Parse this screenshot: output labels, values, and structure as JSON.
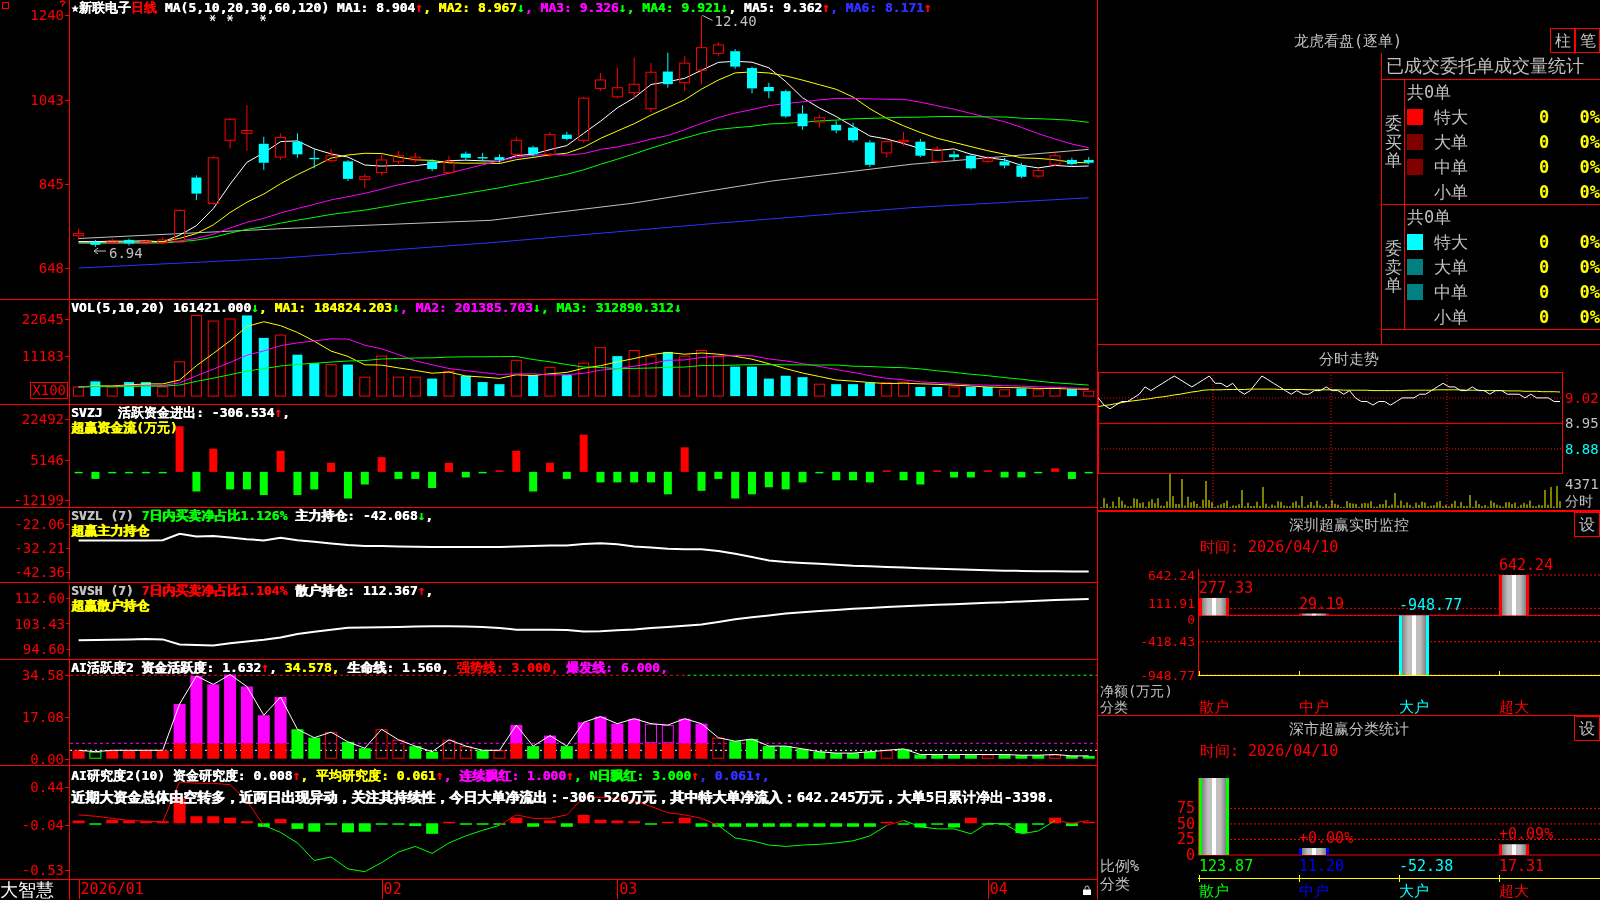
{
  "panels": [
    {
      "kind": "candles",
      "legend_lines": [
        [
          {
            "text": "★新联电子",
            "color": "#ffffff"
          },
          {
            "text": "日线",
            "color": "#ff0000"
          },
          {
            "text": " MA(5,10,20,30,60,120) MA1: 8.904",
            "color": "#ffffff"
          },
          {
            "text": "↑",
            "color": "#ff0000"
          },
          {
            "text": ", MA2: 8.967",
            "color": "#ffff00"
          },
          {
            "text": "↓",
            "color": "#00ff00"
          },
          {
            "text": ", MA3: 9.326",
            "color": "#ff00ff"
          },
          {
            "text": "↓",
            "color": "#00ff00"
          },
          {
            "text": ", MA4: 9.921",
            "color": "#00ff00"
          },
          {
            "text": "↓",
            "color": "#00ff00"
          },
          {
            "text": ", MA5: 9.362",
            "color": "#ffffff"
          },
          {
            "text": "↑",
            "color": "#ff0000"
          },
          {
            "text": ", MA6: 8.171",
            "color": "#3030ff"
          },
          {
            "text": "↑",
            "color": "#ff0000"
          }
        ]
      ],
      "yticks": [
        "1240",
        "1043",
        "845",
        "648"
      ],
      "peak_label": "12.40",
      "low_label": "6.94"
    },
    {
      "kind": "volume",
      "legend_lines": [
        [
          {
            "text": "VOL(5,10,20) 161421.000",
            "color": "#ffffff"
          },
          {
            "text": "↓",
            "color": "#00ff00"
          },
          {
            "text": ", MA1: 184824.203",
            "color": "#ffff00"
          },
          {
            "text": "↓",
            "color": "#00ff00"
          },
          {
            "text": ", MA2: 201385.703",
            "color": "#ff00ff"
          },
          {
            "text": "↓",
            "color": "#00ff00"
          },
          {
            "text": ", MA3: 312890.312",
            "color": "#00ff00"
          },
          {
            "text": "↓",
            "color": "#00ff00"
          }
        ]
      ],
      "yticks": [
        "22645",
        "11183"
      ],
      "unit": "X100"
    },
    {
      "kind": "flow_bars",
      "legend_lines": [
        [
          {
            "text": "SVZJ  活跃资金进出: -306.534",
            "color": "#ffffff"
          },
          {
            "text": "↑",
            "color": "#ff0000"
          },
          {
            "text": ",",
            "color": "#ffffff"
          }
        ],
        [
          {
            "text": "超赢资金流(万元)",
            "color": "#ffff00"
          }
        ]
      ],
      "yticks": [
        "22492",
        "5146",
        "-12199"
      ]
    },
    {
      "kind": "holding_line",
      "legend_lines": [
        [
          {
            "text": "SVZL (7) ",
            "color": "#c0c0c0"
          },
          {
            "text": "7日内买卖净占比1.126%",
            "color": "#00ff00"
          },
          {
            "text": " 主力持仓: -42.068",
            "color": "#ffffff"
          },
          {
            "text": "↓",
            "color": "#00ff00"
          },
          {
            "text": ",",
            "color": "#ffffff"
          }
        ],
        [
          {
            "text": "超赢主力持仓",
            "color": "#ffff00"
          }
        ]
      ],
      "chart_data": {
        "type": "line",
        "ylim": [
          -45.74,
          -16.14
        ],
        "yticks": [
          {
            "value": -22.06,
            "label": "-22.06"
          },
          {
            "value": -32.21,
            "label": "-32.21"
          },
          {
            "value": -42.36,
            "label": "-42.36"
          }
        ],
        "series": [
          {
            "color": "#ffffff",
            "values": [
              -29.1,
              -29.1,
              -29.1,
              -29.1,
              -29.1,
              -28.9,
              -26.2,
              -27.3,
              -27.1,
              -27.8,
              -28.5,
              -29.0,
              -27.9,
              -28.9,
              -29.6,
              -30.3,
              -31.0,
              -31.3,
              -31.4,
              -31.6,
              -31.7,
              -31.8,
              -31.8,
              -31.8,
              -31.8,
              -31.8,
              -31.6,
              -31.4,
              -31.2,
              -31.2,
              -30.5,
              -30.2,
              -30.6,
              -31.6,
              -32.0,
              -32.5,
              -32.7,
              -32.7,
              -33.5,
              -34.6,
              -36.0,
              -37.5,
              -38.1,
              -38.5,
              -38.9,
              -39.3,
              -39.7,
              -39.9,
              -40.2,
              -40.5,
              -40.8,
              -41.0,
              -41.2,
              -41.4,
              -41.6,
              -41.8,
              -41.9,
              -42.0,
              -42.0,
              -42.1,
              -42.1
            ]
          }
        ]
      }
    },
    {
      "kind": "holding_line",
      "legend_lines": [
        [
          {
            "text": "SVSH (7) ",
            "color": "#c0c0c0"
          },
          {
            "text": "7日内买卖净占比1.104%",
            "color": "#ff0000"
          },
          {
            "text": " 散户持仓: 112.367",
            "color": "#ffffff"
          },
          {
            "text": "↑",
            "color": "#ff0000"
          },
          {
            "text": ",",
            "color": "#ffffff"
          }
        ],
        [
          {
            "text": "超赢散户持仓",
            "color": "#ffff00"
          }
        ]
      ],
      "chart_data": {
        "type": "line",
        "ylim": [
          91.78,
          117.19
        ],
        "yticks": [
          {
            "value": 112.6,
            "label": "112.60"
          },
          {
            "value": 103.43,
            "label": "103.43"
          },
          {
            "value": 94.6,
            "label": "94.60"
          }
        ],
        "series": [
          {
            "color": "#ffffff",
            "values": [
              97.7,
              97.8,
              97.9,
              98.0,
              98.1,
              98.0,
              96.2,
              96.0,
              95.8,
              96.6,
              97.3,
              97.9,
              98.7,
              99.9,
              100.7,
              101.4,
              102.1,
              102.2,
              102.3,
              102.4,
              102.5,
              102.6,
              102.6,
              102.5,
              102.4,
              102.0,
              101.4,
              101.4,
              101.4,
              101.3,
              100.8,
              100.9,
              101.2,
              101.5,
              102.0,
              102.4,
              102.8,
              103.2,
              104.1,
              105.1,
              105.8,
              106.4,
              107.1,
              107.6,
              108.0,
              108.4,
              108.8,
              109.1,
              109.4,
              109.7,
              110.0,
              110.2,
              110.4,
              110.7,
              110.9,
              111.1,
              111.4,
              111.6,
              111.9,
              112.1,
              112.3
            ]
          }
        ]
      }
    },
    {
      "kind": "activity_bars",
      "legend_lines": [
        [
          {
            "text": "AI活跃度2 资金活跃度: 1.632",
            "color": "#ffffff"
          },
          {
            "text": "↑",
            "color": "#ff0000"
          },
          {
            "text": ",",
            "color": "#ffffff"
          },
          {
            "text": " 34.578,",
            "color": "#ffff00"
          },
          {
            "text": " 生命线: 1.560,",
            "color": "#ffffff"
          },
          {
            "text": " 强势线: 3.000,",
            "color": "#ff0000"
          },
          {
            "text": " 爆发线: 6.000,",
            "color": "#ff00ff"
          }
        ]
      ],
      "yticks": [
        "34.58",
        "17.08",
        "0.00"
      ]
    },
    {
      "kind": "research_bars",
      "legend_lines": [
        [
          {
            "text": "AI研究度2(10) 资金研究度: 0.008",
            "color": "#ffffff"
          },
          {
            "text": "↑",
            "color": "#ff0000"
          },
          {
            "text": ", 平均研究度: 0.061",
            "color": "#ffff00"
          },
          {
            "text": "↑",
            "color": "#ff0000"
          },
          {
            "text": ", 连续飘红: 1.000",
            "color": "#ff00ff"
          },
          {
            "text": "↑",
            "color": "#ff0000"
          },
          {
            "text": ", N日飘红: 3.000",
            "color": "#00ff00"
          },
          {
            "text": "↑",
            "color": "#ff0000"
          },
          {
            "text": ", 0.061",
            "color": "#3030ff"
          },
          {
            "text": "↑,",
            "color": "#3030ff"
          }
        ],
        [
          {
            "text": "近期大资金总体由空转多，近两日出现异动，关注其持续性，今日大单净流出：-306.526万元，其中特大单净流入：642.245万元，大单5日累计净出-3398.",
            "color": "#ffffff"
          }
        ]
      ],
      "yticks": [
        "0.44",
        "-0.04",
        "-0.53"
      ]
    }
  ],
  "date_axis": {
    "brand": "大智慧",
    "labels": [
      "2026/01",
      "02",
      "03",
      "04"
    ]
  },
  "dragon_tiger": {
    "title": "龙虎看盘(逐单)",
    "view_buttons": [
      "柱",
      "笔"
    ],
    "stats_title": "已成交委托单成交量统计",
    "groups": [
      {
        "label": "委买单",
        "total": "共0单",
        "rows": [
          {
            "label": "特大",
            "color": "#ff0000",
            "count": "0",
            "percent": "0%"
          },
          {
            "label": "大单",
            "color": "#800000",
            "count": "0",
            "percent": "0%"
          },
          {
            "label": "中单",
            "color": "#800000",
            "count": "0",
            "percent": "0%"
          },
          {
            "label": "小单",
            "count": "0",
            "percent": "0%"
          }
        ]
      },
      {
        "label": "委卖单",
        "total": "共0单",
        "rows": [
          {
            "label": "特大",
            "color": "#00ffff",
            "count": "0",
            "percent": "0%"
          },
          {
            "label": "大单",
            "color": "#008080",
            "count": "0",
            "percent": "0%"
          },
          {
            "label": "中单",
            "color": "#008080",
            "count": "0",
            "percent": "0%"
          },
          {
            "label": "小单",
            "count": "0",
            "percent": "0%"
          }
        ]
      }
    ]
  },
  "intraday": {
    "title": "分时走势",
    "price_label_styles": [
      {
        "color": "#ff0000"
      },
      {
        "color": "#c0c0c0"
      },
      {
        "color": "#00ffff"
      }
    ],
    "chart_data": {
      "type": "line",
      "ylim": [
        8.811,
        9.091
      ],
      "yticks": [
        {
          "value": 9.02,
          "label": "9.02"
        },
        {
          "value": 8.95,
          "label": "8.95"
        },
        {
          "value": 8.88,
          "label": "8.88"
        }
      ],
      "grid": true,
      "ref_lines": [
        {
          "axis": "y",
          "value": 8.95
        }
      ],
      "series": [
        {
          "color": "#ffffff",
          "values": [
            9.02,
            9.0,
            8.99,
            9.0,
            9.01,
            9.01,
            9.02,
            9.03,
            9.05,
            9.04,
            9.05,
            9.06,
            9.07,
            9.08,
            9.07,
            9.06,
            9.05,
            9.06,
            9.07,
            9.08,
            9.06,
            9.06,
            9.05,
            9.06,
            9.04,
            9.03,
            9.04,
            9.06,
            9.08,
            9.07,
            9.06,
            9.05,
            9.04,
            9.03,
            9.04,
            9.03,
            9.03,
            9.04,
            9.04,
            9.05,
            9.04,
            9.04,
            9.03,
            9.04,
            9.02,
            9.01,
            9.01,
            9.0,
            9.01,
            9.01,
            9.0,
            9.01,
            9.02,
            9.02,
            9.02,
            9.03,
            9.03,
            9.04,
            9.05,
            9.06,
            9.05,
            9.05,
            9.04,
            9.04,
            9.05,
            9.04,
            9.04,
            9.03,
            9.04,
            9.04,
            9.03,
            9.03,
            9.03,
            9.02,
            9.03,
            9.02,
            9.02,
            9.02,
            9.01,
            9.01
          ]
        },
        {
          "color": "#ffff00",
          "values": [
            8.996,
            8.999,
            9.001,
            9.004,
            9.007,
            9.01,
            9.012,
            9.014,
            9.016,
            9.018,
            9.021,
            9.023,
            9.025,
            9.028,
            9.03,
            9.033,
            9.036,
            9.038,
            9.041,
            9.042,
            9.042,
            9.042,
            9.043,
            9.043,
            9.043,
            9.043,
            9.044,
            9.044,
            9.044,
            9.044,
            9.044,
            9.043,
            9.043,
            9.043,
            9.043,
            9.043,
            9.042,
            9.042,
            9.042,
            9.042,
            9.042,
            9.042,
            9.041,
            9.041,
            9.041,
            9.041,
            9.041,
            9.04,
            9.04,
            9.04,
            9.04,
            9.04,
            9.04,
            9.041,
            9.041,
            9.041,
            9.041,
            9.041,
            9.042,
            9.042,
            9.042,
            9.042,
            9.042,
            9.041,
            9.041,
            9.041,
            9.04,
            9.04,
            9.04,
            9.04,
            9.039,
            9.039,
            9.039,
            9.038,
            9.038,
            9.038,
            9.037,
            9.037,
            9.037,
            9.036
          ]
        }
      ]
    },
    "volume_label": "4371",
    "period_label": "分时"
  },
  "shenzhen_monitor": {
    "title": "深圳超赢实时监控",
    "settings_button": "设",
    "time": "时间: 2026/04/10",
    "y_title": "净额(万元)",
    "x_title": "分类",
    "chart_data": {
      "type": "bar",
      "categories": [
        "散户",
        "中户",
        "大户",
        "超大"
      ],
      "values": [
        277.33,
        29.19,
        -948.77,
        642.24
      ],
      "ylim": [
        -948.77,
        642.24
      ],
      "yticks": [
        {
          "value": 642.24,
          "label": "642.24"
        },
        {
          "value": 111.91,
          "label": "111.91"
        },
        {
          "value": 0,
          "label": "0"
        },
        {
          "value": -418.43,
          "label": "-418.43"
        },
        {
          "value": -948.77,
          "label": "-948.77"
        }
      ],
      "grid": true,
      "ref_lines": [
        {
          "axis": "y",
          "value": 0
        }
      ],
      "data_labels": true
    }
  },
  "shenzhen_classify": {
    "title": "深市超赢分类统计",
    "settings_button": "设",
    "time": "时间: 2026/04/10",
    "y_title": "比例%",
    "x_title": "分类",
    "category_styles": [
      {
        "color": "#00ff00"
      },
      {
        "color": "#0000ff"
      },
      {
        "color": "#00ffff"
      },
      {
        "color": "#ff0000"
      }
    ],
    "chart_data": {
      "type": "bar",
      "categories": [
        "散户",
        "中户",
        "大户",
        "超大"
      ],
      "values": [
        123.87,
        11.2,
        null,
        17.31
      ],
      "value_labels": [
        "123.87",
        "11.20",
        "-52.38",
        "17.31"
      ],
      "ylim": [
        0,
        123.87
      ],
      "yticks": [
        0,
        25,
        50,
        75
      ],
      "grid": true,
      "annotations": [
        {
          "x": "中户",
          "y": 11.2,
          "text": "+0.00%"
        },
        {
          "x": "超大",
          "y": 17.31,
          "text": "+0.09%"
        }
      ]
    }
  }
}
